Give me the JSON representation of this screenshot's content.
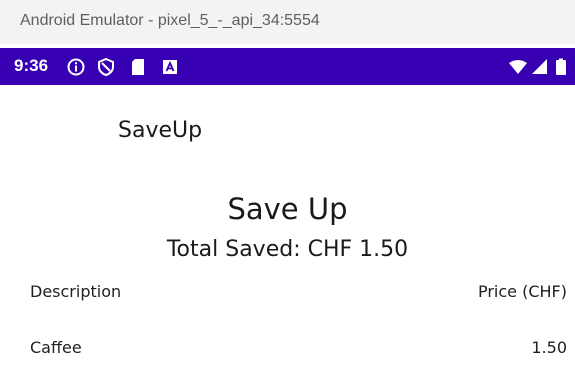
{
  "window": {
    "title": "Android Emulator - pixel_5_-_api_34:5554"
  },
  "status_bar": {
    "time": "9:36",
    "icons_left": [
      "info-icon",
      "shield-icon",
      "sd-card-icon",
      "a-badge-icon"
    ],
    "icons_right": [
      "wifi-icon",
      "signal-icon",
      "battery-icon"
    ],
    "color": "#3700b3"
  },
  "app_bar": {
    "title": "SaveUp"
  },
  "main": {
    "heading": "Save Up",
    "total_saved": "Total Saved: CHF 1.50",
    "table": {
      "headers": {
        "description": "Description",
        "price": "Price (CHF)"
      },
      "rows": [
        {
          "description": "Caffee",
          "price": "1.50"
        }
      ]
    }
  }
}
